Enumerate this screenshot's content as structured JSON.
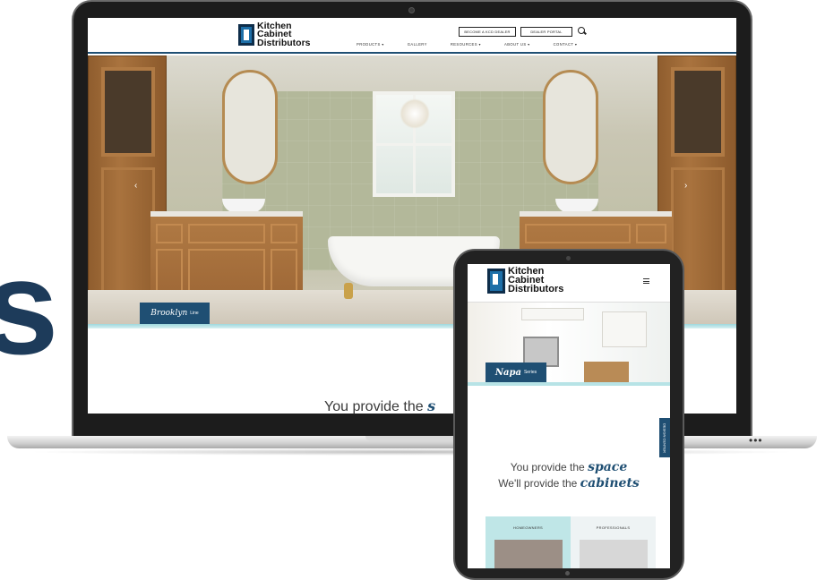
{
  "background_letter": "s",
  "brand": {
    "logo_lines": [
      "Kitchen",
      "Cabinet",
      "Distributors"
    ],
    "primary_color": "#1f4f73",
    "accent_color": "#9fd8dd"
  },
  "laptop": {
    "header": {
      "buttons": [
        "BECOME A KCD DEALER",
        "DEALER PORTAL"
      ],
      "nav": [
        "PRODUCTS ▾",
        "GALLERY",
        "RESOURCES ▾",
        "ABOUT US ▾",
        "CONTACT ▾"
      ]
    },
    "hero": {
      "line_script": "Brooklyn",
      "line_suffix": "Line",
      "prev_arrow": "‹",
      "next_arrow": "›"
    },
    "tagline_start": "You provide the",
    "tagline_script": "s"
  },
  "tablet": {
    "hero": {
      "line_script": "Napa",
      "line_suffix": "Series"
    },
    "side_button": "DESIGN CENTER",
    "tagline_line1_start": "You provide the",
    "tagline_line1_script": "space",
    "tagline_line2_start": "We'll provide the",
    "tagline_line2_script": "cabinets",
    "cards": [
      "HOMEOWNERS",
      "PROFESSIONALS"
    ]
  },
  "dots": "•••"
}
